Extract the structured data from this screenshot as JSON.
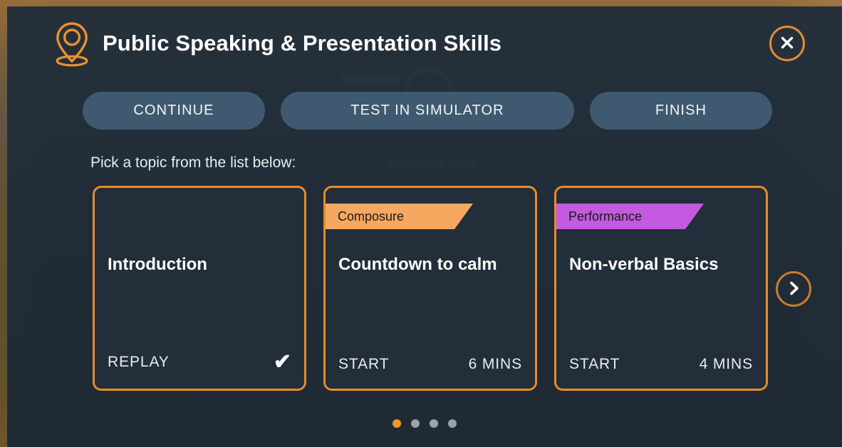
{
  "header": {
    "pin_icon": "location-pin-icon",
    "title": "Public Speaking & Presentation Skills",
    "close_icon": "close-icon",
    "close_label": "Close"
  },
  "actions": {
    "continue_label": "CONTINUE",
    "test_simulator_label": "TEST IN SIMULATOR",
    "finish_label": "FINISH"
  },
  "main": {
    "list_prompt": "Pick a topic from the list below:",
    "cards": [
      {
        "ribbon": "",
        "title": "Introduction",
        "action": "REPLAY",
        "duration": "",
        "completed_icon": "checkmark-icon",
        "completed_glyph": "✔"
      },
      {
        "ribbon": "Composure",
        "title": "Countdown to calm",
        "action": "START",
        "duration": "6 MINS",
        "completed_icon": "",
        "completed_glyph": ""
      },
      {
        "ribbon": "Performance",
        "title": "Non-verbal Basics",
        "action": "START",
        "duration": "4 MINS",
        "completed_icon": "",
        "completed_glyph": ""
      }
    ],
    "next_icon": "chevron-right-icon",
    "pagination": {
      "total": 4,
      "active_index": 0
    }
  },
  "background_ghost_text": {
    "confidence_rating": "Confidence rating"
  },
  "colors": {
    "accent_orange": "#e58b2e",
    "ribbon_composure": "#f6a860",
    "ribbon_performance": "#c35ae0",
    "button_slate": "#3f5a70",
    "modal_background": "#232f3a",
    "card_background": "#222e39",
    "dot_active": "#f59625",
    "dot_inactive": "#9aa3aa"
  }
}
